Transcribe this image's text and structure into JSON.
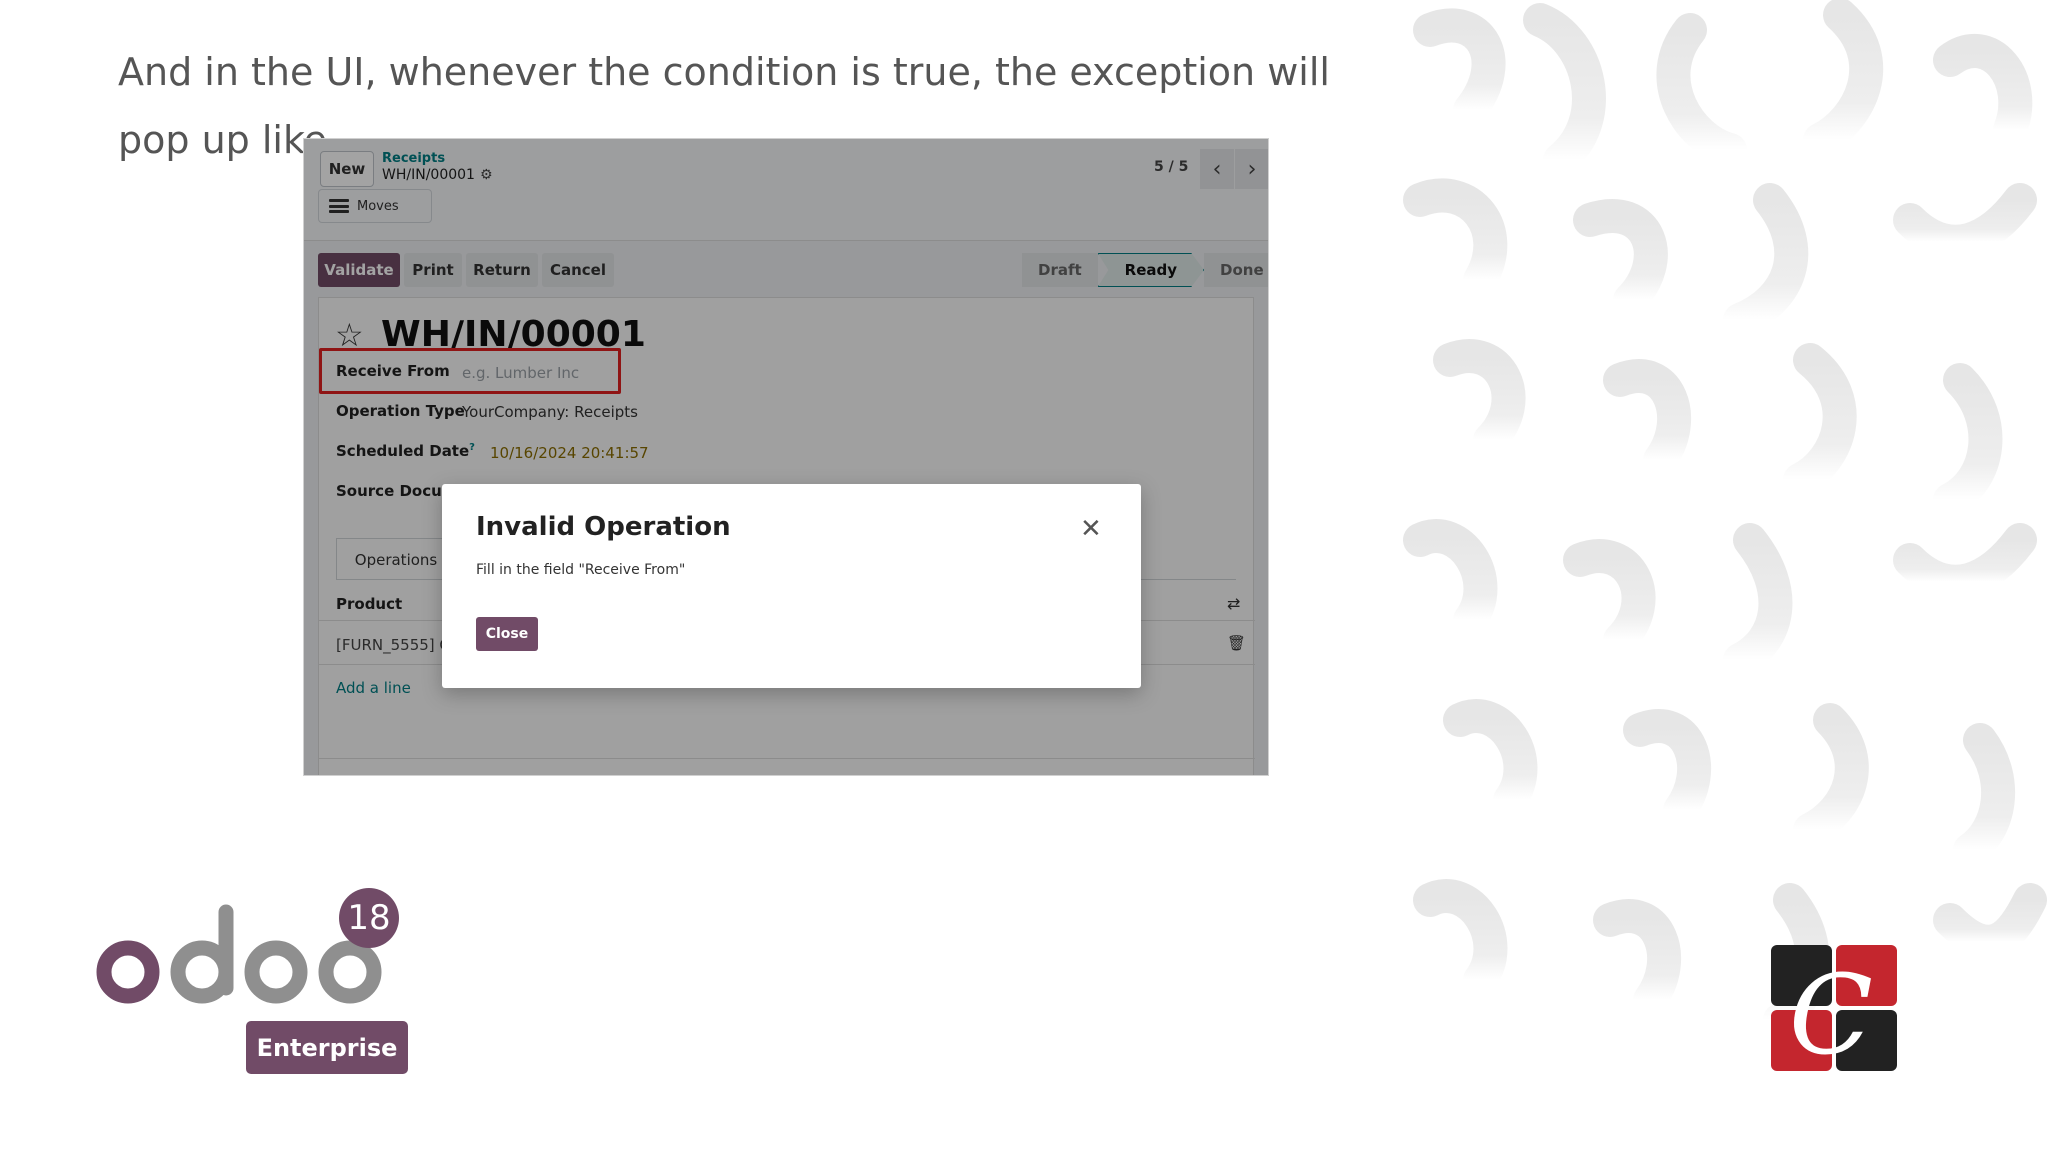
{
  "slide": {
    "caption": "And in the UI, whenever the condition is true, the exception will pop up like"
  },
  "screenshot": {
    "control_panel": {
      "new_label": "New",
      "breadcrumb_parent": "Receipts",
      "breadcrumb_current": "WH/IN/00001",
      "moves_label": "Moves",
      "pager": "5 / 5"
    },
    "statusbar": {
      "buttons": [
        "Validate",
        "Print",
        "Return",
        "Cancel"
      ],
      "stages": [
        "Draft",
        "Ready",
        "Done"
      ],
      "active_stage": "Ready"
    },
    "form": {
      "title": "WH/IN/00001",
      "receive_from_label": "Receive From",
      "receive_from_placeholder": "e.g. Lumber Inc",
      "operation_type_label": "Operation Type",
      "operation_type_value": "YourCompany: Receipts",
      "scheduled_date_label": "Scheduled Date",
      "scheduled_date_help": "?",
      "scheduled_date_value": "10/16/2024 20:41:57",
      "source_document_label": "Source Docume",
      "tab_operations": "Operations",
      "column_product": "Product",
      "row_product": "[FURN_5555] C",
      "add_line": "Add a line"
    },
    "dialog": {
      "title": "Invalid Operation",
      "message": "Fill in the field \"Receive From\"",
      "close_button": "Close"
    }
  },
  "branding": {
    "odoo_version": "18",
    "edition": "Enterprise",
    "accent_color": "#714b67",
    "logo_gray": "#8f8f8f"
  }
}
